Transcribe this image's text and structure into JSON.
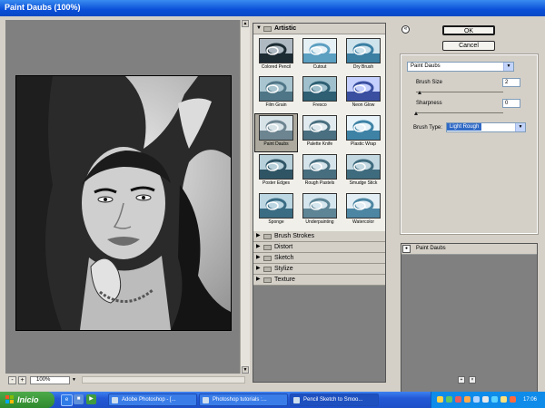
{
  "window": {
    "title": "Paint Daubs (100%)"
  },
  "preview": {
    "zoom": "100%",
    "zoom_out": "-",
    "zoom_in": "+"
  },
  "gallery": {
    "open_category": "Artistic",
    "filters": [
      {
        "label": "Colored Pencil"
      },
      {
        "label": "Cutout"
      },
      {
        "label": "Dry Brush"
      },
      {
        "label": "Film Grain"
      },
      {
        "label": "Fresco"
      },
      {
        "label": "Neon Glow"
      },
      {
        "label": "Paint Daubs"
      },
      {
        "label": "Palette Knife"
      },
      {
        "label": "Plastic Wrap"
      },
      {
        "label": "Poster Edges"
      },
      {
        "label": "Rough Pastels"
      },
      {
        "label": "Smudge Stick"
      },
      {
        "label": "Sponge"
      },
      {
        "label": "Underpainting"
      },
      {
        "label": "Watercolor"
      }
    ],
    "selected_filter": "Paint Daubs",
    "categories": [
      {
        "label": "Brush Strokes"
      },
      {
        "label": "Distort"
      },
      {
        "label": "Sketch"
      },
      {
        "label": "Stylize"
      },
      {
        "label": "Texture"
      }
    ]
  },
  "buttons": {
    "ok": "OK",
    "cancel": "Cancel"
  },
  "settings": {
    "filter_select": "Paint Daubs",
    "brush_size_label": "Brush Size",
    "brush_size_value": "2",
    "brush_size_fraction": 0.04,
    "sharpness_label": "Sharpness",
    "sharpness_value": "0",
    "sharpness_fraction": 0.0,
    "brush_type_label": "Brush Type:",
    "brush_type_value": "Light Rough"
  },
  "layers": {
    "items": [
      {
        "label": "Paint Daubs"
      }
    ]
  },
  "taskbar": {
    "start_label": "Inicio",
    "tasks": [
      {
        "label": "Adobe Photoshop - [..."
      },
      {
        "label": "Photoshop tutorials :..."
      },
      {
        "label": "Pencil Sketch to Smoo..."
      }
    ],
    "clock": "17:06"
  },
  "colors": {
    "title_bar": "#0a4fd8",
    "taskbar": "#2459d6",
    "start_button": "#2e8a2e",
    "selected_brush_type": "#316ac5"
  }
}
